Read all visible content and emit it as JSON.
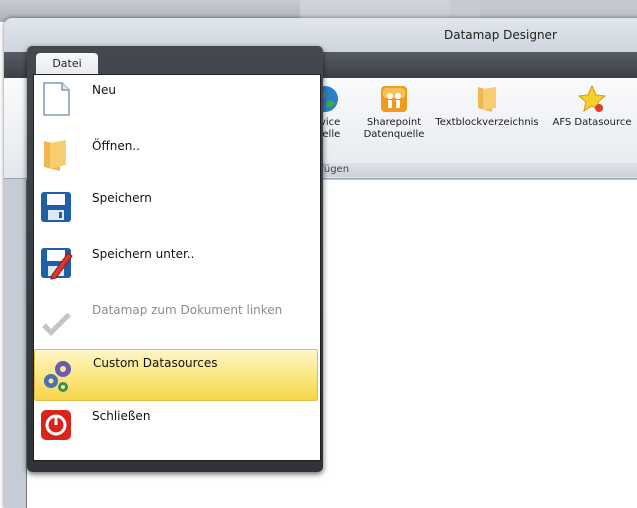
{
  "window": {
    "title": "Datamap Designer"
  },
  "ribbon": {
    "items": [
      {
        "label_line1": "ervice",
        "label_line2": "quelle",
        "icon": "globe-icon"
      },
      {
        "label_line1": "Sharepoint",
        "label_line2": "Datenquelle",
        "icon": "sharepoint-icon"
      },
      {
        "label_line1": "Textblockverzeichnis",
        "label_line2": "",
        "icon": "folder-icon"
      },
      {
        "label_line1": "AFS Datasource",
        "label_line2": "",
        "icon": "star-icon"
      }
    ],
    "group_label": "nfügen"
  },
  "file_menu": {
    "tab_label": "Datei",
    "items": [
      {
        "label": "Neu",
        "icon": "new-document-icon",
        "enabled": true
      },
      {
        "label": "Öffnen..",
        "icon": "open-folder-icon",
        "enabled": true
      },
      {
        "label": "Speichern",
        "icon": "save-disk-icon",
        "enabled": true
      },
      {
        "label": "Speichern unter..",
        "icon": "save-as-icon",
        "enabled": true
      },
      {
        "label": "Datamap zum Dokument linken",
        "icon": "checkmark-icon",
        "enabled": false
      },
      {
        "label": "Custom Datasources",
        "icon": "gears-icon",
        "enabled": true,
        "highlighted": true
      },
      {
        "label": "Schließen",
        "icon": "close-power-icon",
        "enabled": true
      }
    ]
  },
  "colors": {
    "highlight": "#f6d54a",
    "menu_frame": "#3a3d43",
    "disabled_text": "#8c8c8c"
  }
}
